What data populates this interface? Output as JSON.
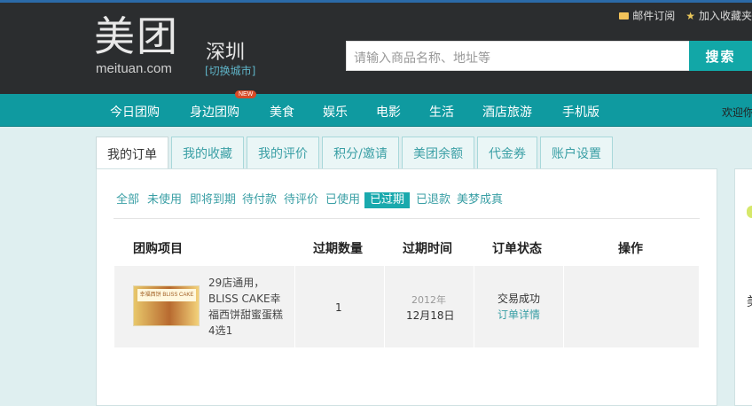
{
  "header": {
    "logo_cn": "美团",
    "logo_en": "meituan.com",
    "city": "深圳",
    "switch_city": "[切换城市]",
    "mail_subscribe": "邮件订阅",
    "add_favorite": "加入收藏夹",
    "search_placeholder": "请输入商品名称、地址等",
    "search_button": "搜索"
  },
  "nav": {
    "items": [
      "今日团购",
      "身边团购",
      "美食",
      "娱乐",
      "电影",
      "生活",
      "酒店旅游",
      "手机版"
    ],
    "new_badge": "NEW",
    "welcome": "欢迎你"
  },
  "tabs": [
    "我的订单",
    "我的收藏",
    "我的评价",
    "积分/邀请",
    "美团余额",
    "代金券",
    "账户设置"
  ],
  "active_tab": "我的订单",
  "filters": [
    "全部",
    "未使用",
    "即将到期",
    "待付款",
    "待评价",
    "已使用",
    "已过期",
    "已退款",
    "美梦成真"
  ],
  "active_filter": "已过期",
  "table": {
    "headers": [
      "团购项目",
      "过期数量",
      "过期时间",
      "订单状态",
      "操作"
    ],
    "rows": [
      {
        "thumb_text": "幸福西饼 BLISS CAKE",
        "title": "29店通用，BLISS CAKE幸福西饼甜蜜蛋糕4选1",
        "quantity": "1",
        "year": "2012年",
        "date": "12月18日",
        "status": "交易成功",
        "detail_link": "订单详情"
      }
    ]
  },
  "side": {
    "char": "美"
  },
  "colors": {
    "header_bg": "#2b2d2f",
    "accent": "#12a7a7",
    "nav_bg": "#0f9aa0",
    "page_bg": "#dfeff0"
  }
}
